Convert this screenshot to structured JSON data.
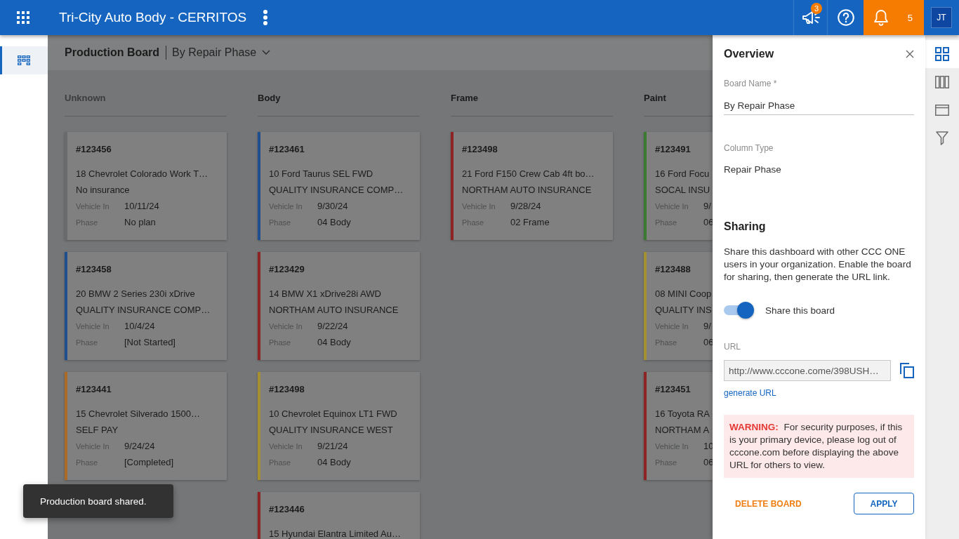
{
  "app_bar": {
    "title": "Tri-City Auto Body - CERRITOS",
    "announcement_badge": "3",
    "notification_count": "5",
    "avatar": "JT"
  },
  "nav": [
    {
      "selected": true
    }
  ],
  "board": {
    "title": "Production Board",
    "view": "By Repair Phase",
    "columns": [
      {
        "title": "Unknown",
        "muted": true,
        "cards": [
          {
            "number": "#123456",
            "color": "#6b6b6b",
            "vehicle": "18 Chevrolet Colorado Work T…",
            "insurance": "No insurance",
            "fields": [
              {
                "label": "Vehicle In",
                "value": "10/11/24"
              },
              {
                "label": "Phase",
                "value": "No plan"
              }
            ]
          },
          {
            "number": "#123458",
            "color": "#1f4f8f",
            "vehicle": "20 BMW 2 Series 230i xDrive",
            "insurance": "QUALITY INSURANCE COMP…",
            "fields": [
              {
                "label": "Vehicle In",
                "value": "10/4/24"
              },
              {
                "label": "Phase",
                "value": "[Not Started]"
              }
            ]
          },
          {
            "number": "#123441",
            "color": "#ab6a25",
            "vehicle": "15 Chevrolet Silverado 1500…",
            "insurance": "SELF PAY",
            "fields": [
              {
                "label": "Vehicle In",
                "value": "9/24/24"
              },
              {
                "label": "Phase",
                "value": "[Completed]"
              }
            ]
          }
        ]
      },
      {
        "title": "Body",
        "muted": false,
        "cards": [
          {
            "number": "#123461",
            "color": "#1f4f8f",
            "vehicle": "10 Ford Taurus SEL FWD",
            "insurance": "QUALITY INSURANCE COMP…",
            "fields": [
              {
                "label": "Vehicle In",
                "value": "9/30/24"
              },
              {
                "label": "Phase",
                "value": "04 Body"
              }
            ]
          },
          {
            "number": "#123429",
            "color": "#8d2323",
            "vehicle": "14 BMW X1 xDrive28i AWD",
            "insurance": "NORTHAM AUTO INSURANCE",
            "fields": [
              {
                "label": "Vehicle In",
                "value": "9/22/24"
              },
              {
                "label": "Phase",
                "value": "04 Body"
              }
            ]
          },
          {
            "number": "#123498",
            "color": "#a68f30",
            "vehicle": "10 Chevrolet Equinox LT1 FWD",
            "insurance": "QUALITY INSURANCE WEST",
            "fields": [
              {
                "label": "Vehicle In",
                "value": "9/21/24"
              },
              {
                "label": "Phase",
                "value": "04 Body"
              }
            ]
          },
          {
            "number": "#123446",
            "color": "#8d2323",
            "vehicle": "15 Hyundai Elantra Limited Au…"
          }
        ]
      },
      {
        "title": "Frame",
        "muted": false,
        "cards": [
          {
            "number": "#123498",
            "color": "#8d2323",
            "vehicle": "21 Ford F150 Crew Cab 4ft bo…",
            "insurance": "NORTHAM AUTO INSURANCE",
            "fields": [
              {
                "label": "Vehicle In",
                "value": "9/28/24"
              },
              {
                "label": "Phase",
                "value": "02 Frame"
              }
            ]
          }
        ]
      },
      {
        "title": "Paint",
        "muted": false,
        "cards": [
          {
            "number": "#123491",
            "color": "#3a7a31",
            "vehicle": "16 Ford Focu",
            "insurance": "SOCAL INSU",
            "fields": [
              {
                "label": "Vehicle In",
                "value": "9/"
              },
              {
                "label": "Phase",
                "value": "06"
              }
            ]
          },
          {
            "number": "#123488",
            "color": "#a68f30",
            "vehicle": "08 MINI Coop",
            "insurance": "QUALITY INS",
            "fields": [
              {
                "label": "Vehicle In",
                "value": "9/"
              },
              {
                "label": "Phase",
                "value": "06"
              }
            ]
          },
          {
            "number": "#123451",
            "color": "#8d2323",
            "vehicle": "16 Toyota RA",
            "insurance": "NORTHAM A",
            "fields": [
              {
                "label": "Vehicle In",
                "value": "10"
              },
              {
                "label": "Phase",
                "value": "06"
              }
            ]
          }
        ]
      }
    ]
  },
  "panel": {
    "title": "Overview",
    "board_name_label": "Board Name *",
    "board_name": "By Repair Phase",
    "column_type_label": "Column Type",
    "column_type": "Repair Phase",
    "sharing_title": "Sharing",
    "sharing_text": "Share this dashboard with other CCC ONE users in your organization. Enable the board for sharing, then generate the URL link.",
    "share_toggle": {
      "label": "Share this board",
      "on": true
    },
    "url_label": "URL",
    "url": "http://www.cccone.come/398USH…",
    "generate_link": "generate URL",
    "warning": "**WARNING:** For security purposes, if this is your primary device, please log out of cccone.com before displaying the above URL for others to view.",
    "delete_button": "DELETE BOARD",
    "apply_button": "APPLY"
  },
  "side_tabs": [
    {
      "kind": "overview",
      "selected": true
    },
    {
      "kind": "columns",
      "selected": false
    },
    {
      "kind": "card",
      "selected": false
    },
    {
      "kind": "filter",
      "selected": false
    }
  ],
  "toast": {
    "message": "Production board shared."
  }
}
